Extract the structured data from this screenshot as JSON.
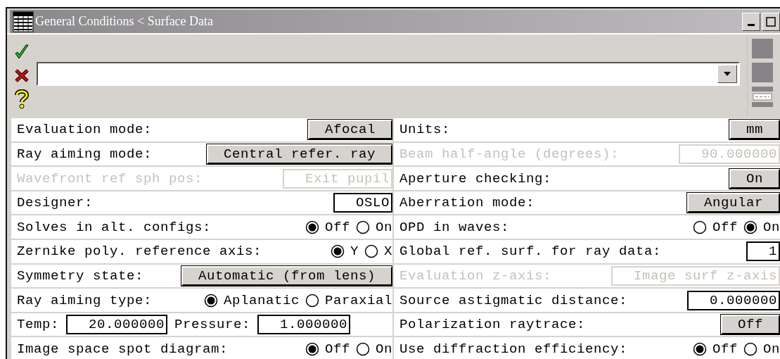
{
  "window": {
    "title": "General Conditions < Surface Data"
  },
  "rows": [
    {
      "left": {
        "disabled": false,
        "items": [
          {
            "kind": "label",
            "text": "Evaluation mode:"
          },
          {
            "kind": "button",
            "text": "Afocal"
          }
        ]
      },
      "right": {
        "disabled": false,
        "items": [
          {
            "kind": "label",
            "text": "Units:"
          },
          {
            "kind": "button",
            "text": "mm"
          }
        ]
      }
    },
    {
      "left": {
        "disabled": false,
        "items": [
          {
            "kind": "label",
            "text": "Ray aiming mode:"
          },
          {
            "kind": "button",
            "text": "Central refer. ray"
          }
        ]
      },
      "right": {
        "disabled": true,
        "items": [
          {
            "kind": "label",
            "text": "Beam half-angle (degrees):"
          },
          {
            "kind": "field",
            "text": "90.000000"
          }
        ]
      }
    },
    {
      "left": {
        "disabled": true,
        "items": [
          {
            "kind": "label",
            "text": "Wavefront ref sph pos:"
          },
          {
            "kind": "field",
            "text": "Exit pupil"
          }
        ]
      },
      "right": {
        "disabled": false,
        "items": [
          {
            "kind": "label",
            "text": "Aperture checking:"
          },
          {
            "kind": "button",
            "text": "On"
          }
        ]
      }
    },
    {
      "left": {
        "disabled": false,
        "items": [
          {
            "kind": "label",
            "text": "Designer:"
          },
          {
            "kind": "field",
            "text": "OSLO"
          }
        ]
      },
      "right": {
        "disabled": false,
        "items": [
          {
            "kind": "label",
            "text": "Aberration mode:"
          },
          {
            "kind": "button",
            "text": "Angular"
          }
        ]
      }
    },
    {
      "left": {
        "disabled": false,
        "items": [
          {
            "kind": "label",
            "text": "Solves in alt. configs:"
          },
          {
            "kind": "radio",
            "options": [
              {
                "label": "Off",
                "selected": true
              },
              {
                "label": "On",
                "selected": false
              }
            ]
          }
        ]
      },
      "right": {
        "disabled": false,
        "items": [
          {
            "kind": "label",
            "text": "OPD in waves:"
          },
          {
            "kind": "radio",
            "options": [
              {
                "label": "Off",
                "selected": false
              },
              {
                "label": "On",
                "selected": true
              }
            ]
          }
        ]
      }
    },
    {
      "left": {
        "disabled": false,
        "items": [
          {
            "kind": "label",
            "text": "Zernike poly. reference axis:"
          },
          {
            "kind": "radio",
            "options": [
              {
                "label": "Y",
                "selected": true
              },
              {
                "label": "X",
                "selected": false
              }
            ]
          }
        ]
      },
      "right": {
        "disabled": false,
        "items": [
          {
            "kind": "label",
            "text": "Global ref. surf. for ray data:"
          },
          {
            "kind": "field",
            "text": "1"
          }
        ]
      }
    },
    {
      "left": {
        "disabled": false,
        "items": [
          {
            "kind": "label",
            "text": "Symmetry state:"
          },
          {
            "kind": "button",
            "text": "Automatic (from lens)"
          }
        ]
      },
      "right": {
        "disabled": true,
        "items": [
          {
            "kind": "label",
            "text": "Evaluation z-axis:"
          },
          {
            "kind": "field",
            "text": "Image surf z-axis"
          }
        ]
      }
    },
    {
      "left": {
        "disabled": false,
        "items": [
          {
            "kind": "label",
            "text": "Ray aiming type:"
          },
          {
            "kind": "radio",
            "options": [
              {
                "label": "Aplanatic",
                "selected": true
              },
              {
                "label": "Paraxial",
                "selected": false
              }
            ]
          }
        ]
      },
      "right": {
        "disabled": false,
        "items": [
          {
            "kind": "label",
            "text": "Source astigmatic distance:"
          },
          {
            "kind": "field",
            "text": "0.000000"
          }
        ]
      }
    },
    {
      "left": {
        "disabled": false,
        "items": [
          {
            "kind": "label",
            "text": "Temp:"
          },
          {
            "kind": "field",
            "text": "20.000000"
          },
          {
            "kind": "label",
            "text": "Pressure:"
          },
          {
            "kind": "field",
            "text": "1.000000"
          }
        ]
      },
      "right": {
        "disabled": false,
        "items": [
          {
            "kind": "label",
            "text": "Polarization raytrace:"
          },
          {
            "kind": "button",
            "text": "Off"
          }
        ]
      }
    },
    {
      "left": {
        "disabled": false,
        "items": [
          {
            "kind": "label",
            "text": "Image space spot diagram:"
          },
          {
            "kind": "radio",
            "options": [
              {
                "label": "Off",
                "selected": true
              },
              {
                "label": "On",
                "selected": false
              }
            ]
          }
        ]
      },
      "right": {
        "disabled": false,
        "items": [
          {
            "kind": "label",
            "text": "Use diffraction efficiency:"
          },
          {
            "kind": "radio",
            "options": [
              {
                "label": "Off",
                "selected": true
              },
              {
                "label": "On",
                "selected": false
              }
            ]
          }
        ]
      }
    }
  ]
}
